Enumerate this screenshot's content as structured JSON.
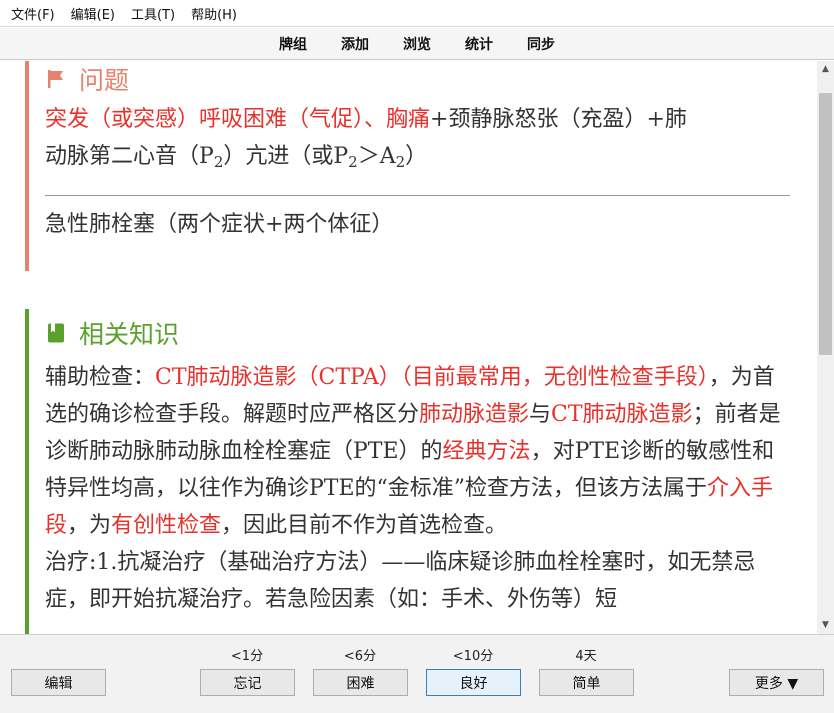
{
  "menubar": {
    "items": [
      "文件(F)",
      "编辑(E)",
      "工具(T)",
      "帮助(H)"
    ]
  },
  "toolbar": {
    "items": [
      "牌组",
      "添加",
      "浏览",
      "统计",
      "同步"
    ]
  },
  "question_card": {
    "title": "问题",
    "icon": "flag-icon",
    "color": "#e6836d",
    "line1_red": "突发（或突感）呼吸困难（气促）、胸痛",
    "line1_black": "+颈静脉怒张（充盈）+肺",
    "line2_a": "动脉第二心音（P",
    "sub1": "2",
    "line2_b": "）亢进（或P",
    "sub2": "2",
    "line2_c": "＞A",
    "sub3": "2",
    "line2_d": "）",
    "answer": "急性肺栓塞（两个症状+两个体征）"
  },
  "knowledge_card": {
    "title": "相关知识",
    "icon": "book-icon",
    "color": "#5aa02c",
    "p1_1": "辅助检查：",
    "p1_2": "CT肺动脉造影（CTPA）（目前最常用，无创性检查手段）",
    "p1_3": "，为首选的确诊检查手段。解题时应严格区分",
    "p1_4": "肺动脉造影",
    "p1_5": "与",
    "p1_6": "CT肺动脉造影",
    "p1_7": "；前者是诊断肺动脉肺动脉血栓栓塞症（PTE）的",
    "p1_8": "经典方法",
    "p1_9": "，对PTE诊断的敏感性和特异性均高，以往作为确诊PTE的“金标准”检查方法，但该方法属于",
    "p1_10": "介入手段",
    "p1_11": "，为",
    "p1_12": "有创性检查",
    "p1_13": "，因此目前不作为首选检查。",
    "p2": "治疗:1.抗凝治疗（基础治疗方法）——临床疑诊肺血栓栓塞时，如无禁忌症，即开始抗凝治疗。若急险因素（如：手术、外伤等）短"
  },
  "colors": {
    "red_text": "#e8312b",
    "accent_question": "#e6836d",
    "accent_knowledge": "#5aa02c"
  },
  "bottombar": {
    "edit_label": "编辑",
    "more_label": "更多 ▼",
    "answers": [
      {
        "interval": "<1分",
        "label": "忘记"
      },
      {
        "interval": "<6分",
        "label": "困难"
      },
      {
        "interval": "<10分",
        "label": "良好"
      },
      {
        "interval": "4天",
        "label": "简单"
      }
    ]
  }
}
